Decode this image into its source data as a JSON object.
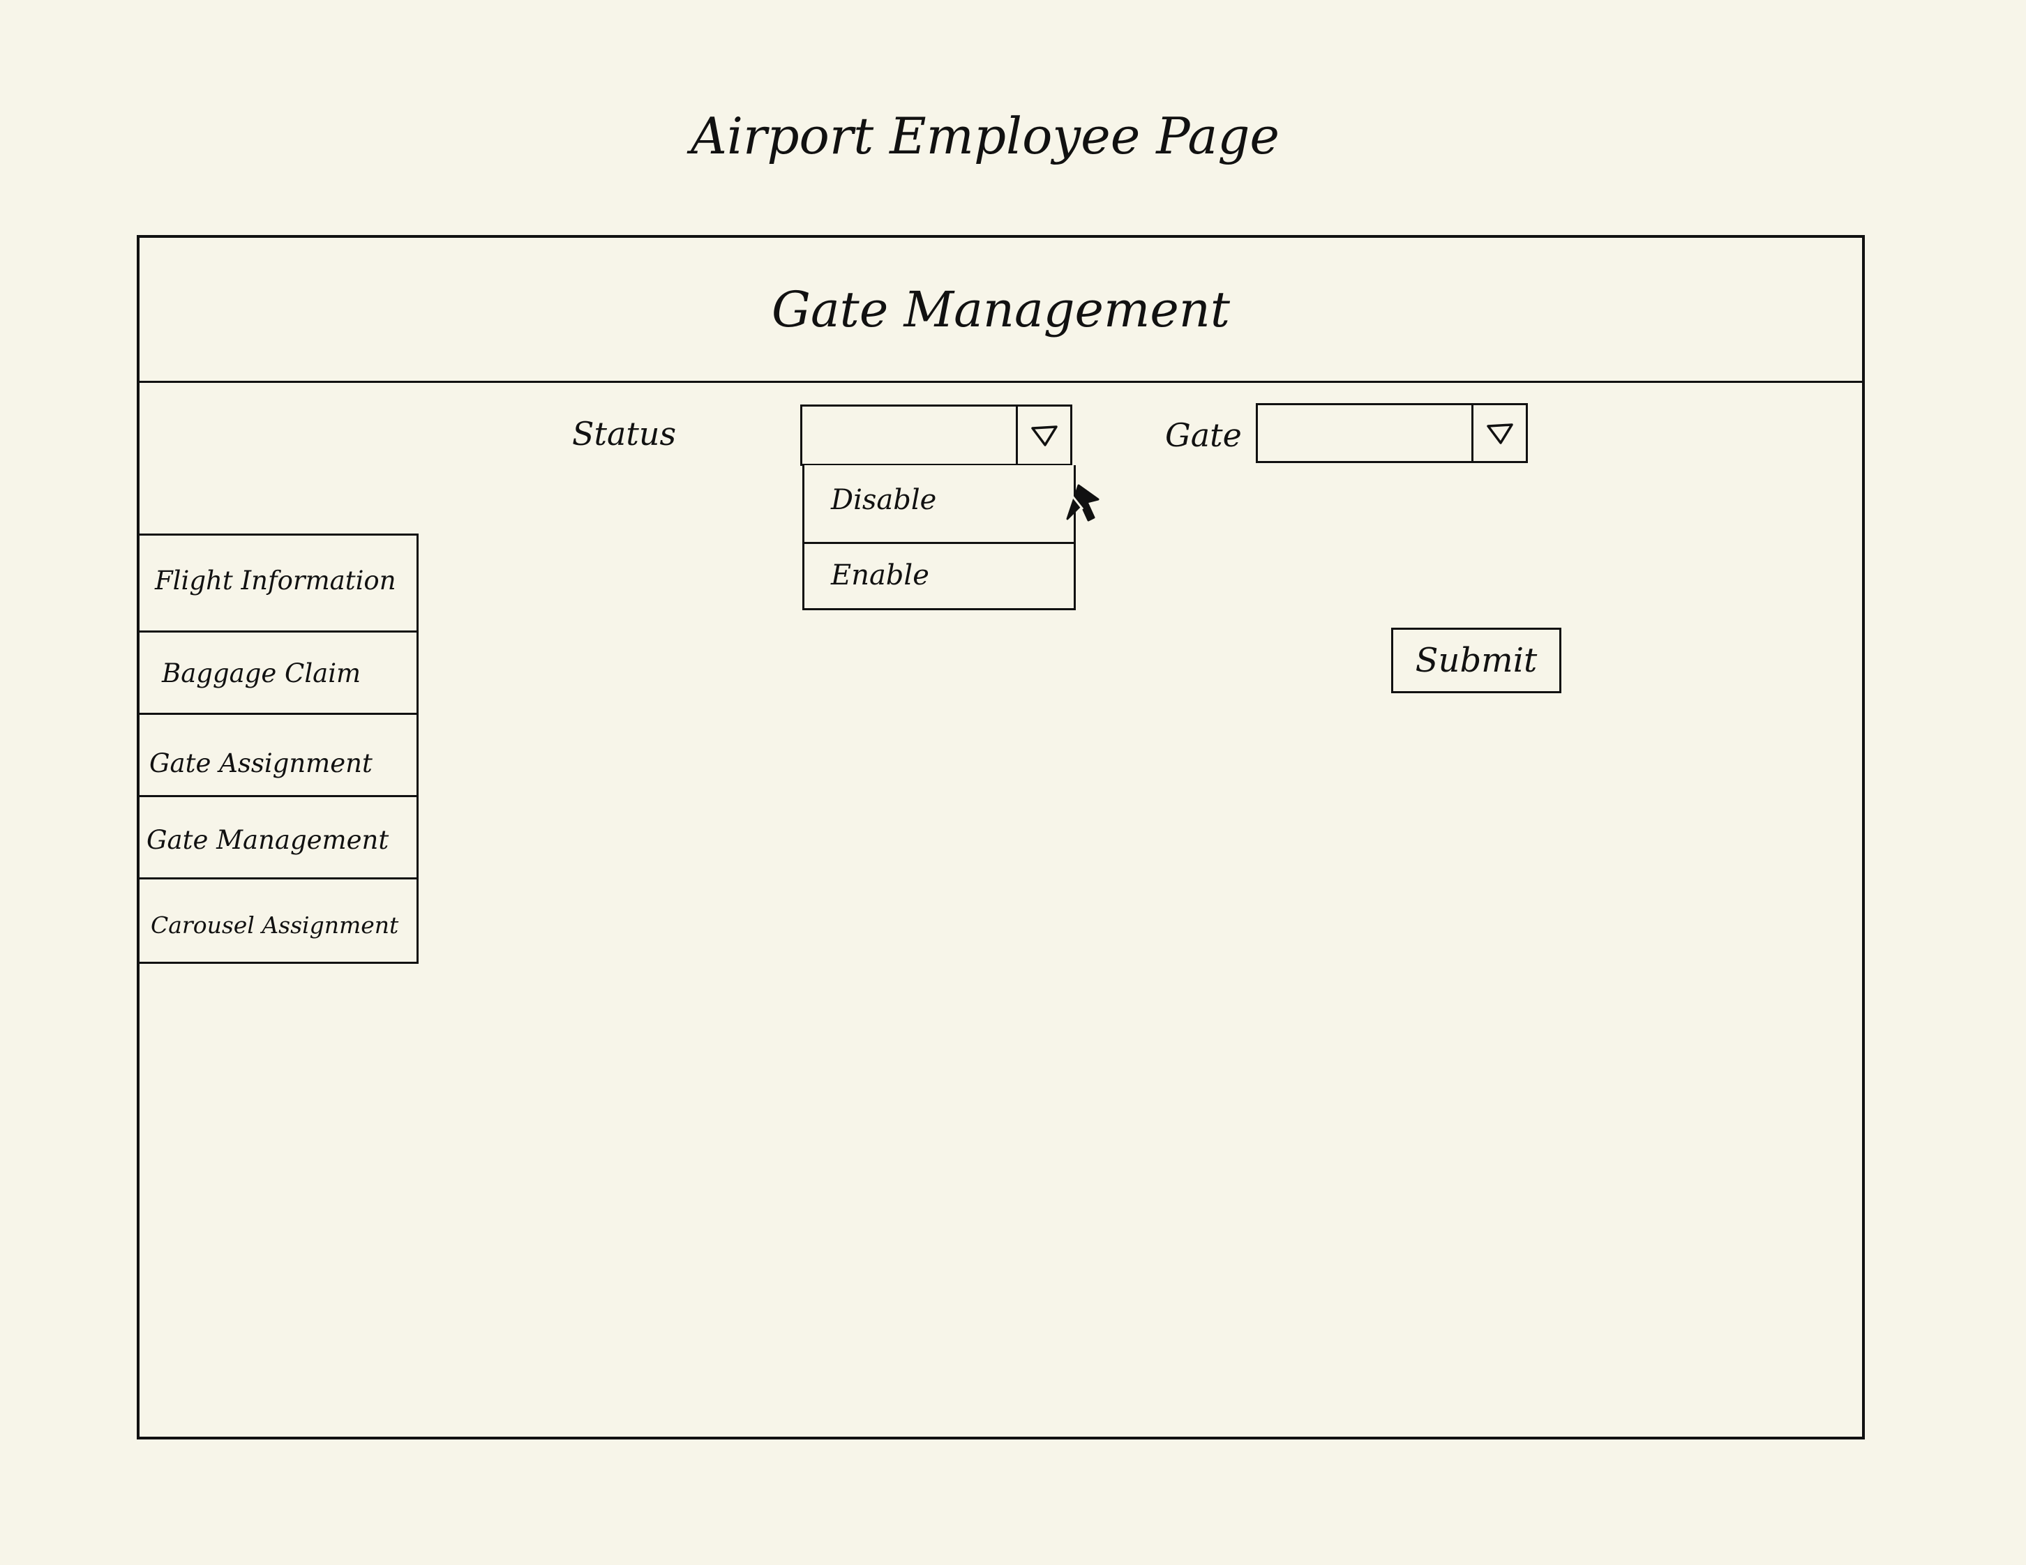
{
  "page": {
    "title": "Airport Employee Page"
  },
  "panel": {
    "title": "Gate Management"
  },
  "sidebar": {
    "items": [
      {
        "label": "Flight Information"
      },
      {
        "label": "Baggage Claim"
      },
      {
        "label": "Gate Assignment"
      },
      {
        "label": "Gate Management"
      },
      {
        "label": "Carousel Assignment"
      }
    ]
  },
  "form": {
    "status": {
      "label": "Status",
      "value": "",
      "open": true,
      "options": [
        "Disable",
        "Enable"
      ],
      "icon": "chevron-down-icon"
    },
    "gate": {
      "label": "Gate",
      "value": "",
      "icon": "chevron-down-icon"
    },
    "submit_label": "Submit"
  },
  "cursor": {
    "icon": "mouse-pointer-icon"
  },
  "colors": {
    "background": "#f7f5e9",
    "ink": "#111111"
  }
}
